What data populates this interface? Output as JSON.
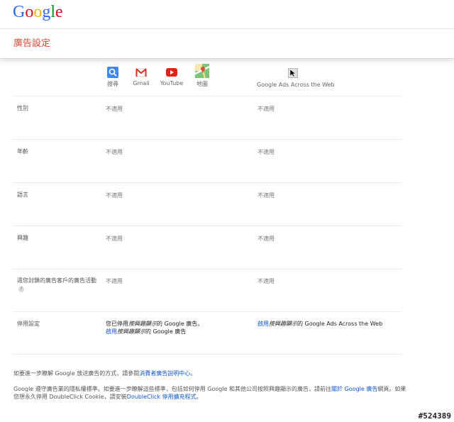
{
  "logo": {
    "letters": [
      "G",
      "o",
      "o",
      "g",
      "l",
      "e"
    ],
    "colors": [
      "#3369e8",
      "#d50f25",
      "#eeb211",
      "#3369e8",
      "#009925",
      "#d50f25"
    ]
  },
  "header": {
    "title": "廣告設定"
  },
  "services": [
    {
      "label": "搜尋",
      "icon": "search-icon"
    },
    {
      "label": "Gmail",
      "icon": "gmail-icon"
    },
    {
      "label": "YouTube",
      "icon": "youtube-icon"
    },
    {
      "label": "地圖",
      "icon": "maps-icon"
    }
  ],
  "web_column": {
    "label": "Google Ads Across the Web",
    "icon": "cursor-icon"
  },
  "rows": [
    {
      "label": "性別",
      "google": "不適用",
      "web": "不適用"
    },
    {
      "label": "年齡",
      "google": "不適用",
      "web": "不適用"
    },
    {
      "label": "語言",
      "google": "不適用",
      "web": "不適用"
    },
    {
      "label": "興趣",
      "google": "不適用",
      "web": "不適用"
    },
    {
      "label": "違您封鎖的廣告客戶的廣告活動",
      "google": "不適用",
      "web": "不適用",
      "help": "?"
    }
  ],
  "optout": {
    "label": "停用設定",
    "google_line1_a": "您已停用",
    "google_line1_em": "按興趣顯示",
    "google_line1_b": "的 Google 廣告。",
    "google_link_a": "啟用",
    "google_link_em": "按興趣顯示",
    "google_link_b": "的 Google 廣告",
    "web_link_a": "啟用",
    "web_link_em": "按興趣顯示",
    "web_link_b": "的 Google Ads Across the Web"
  },
  "footer": {
    "p1_text": "如要進一步瞭解 Google 放送廣告的方式，請參閱",
    "p1_link": "消費者廣告說明中心",
    "p1_end": "。",
    "p2_text": "Google 遵守廣告業的隱私權標準。如要進一步瞭解這些標準，包括如何停用 Google 和其他公司按照興趣顯示的廣告，請前往",
    "p2_link1": "關於 Google 廣告",
    "p2_mid": "網頁。如果您想永久停用 DoubleClick Cookie，請安裝",
    "p2_link2": "DoubleClick 停用擴充程式",
    "p2_end": "。"
  },
  "watermark": "#524389"
}
